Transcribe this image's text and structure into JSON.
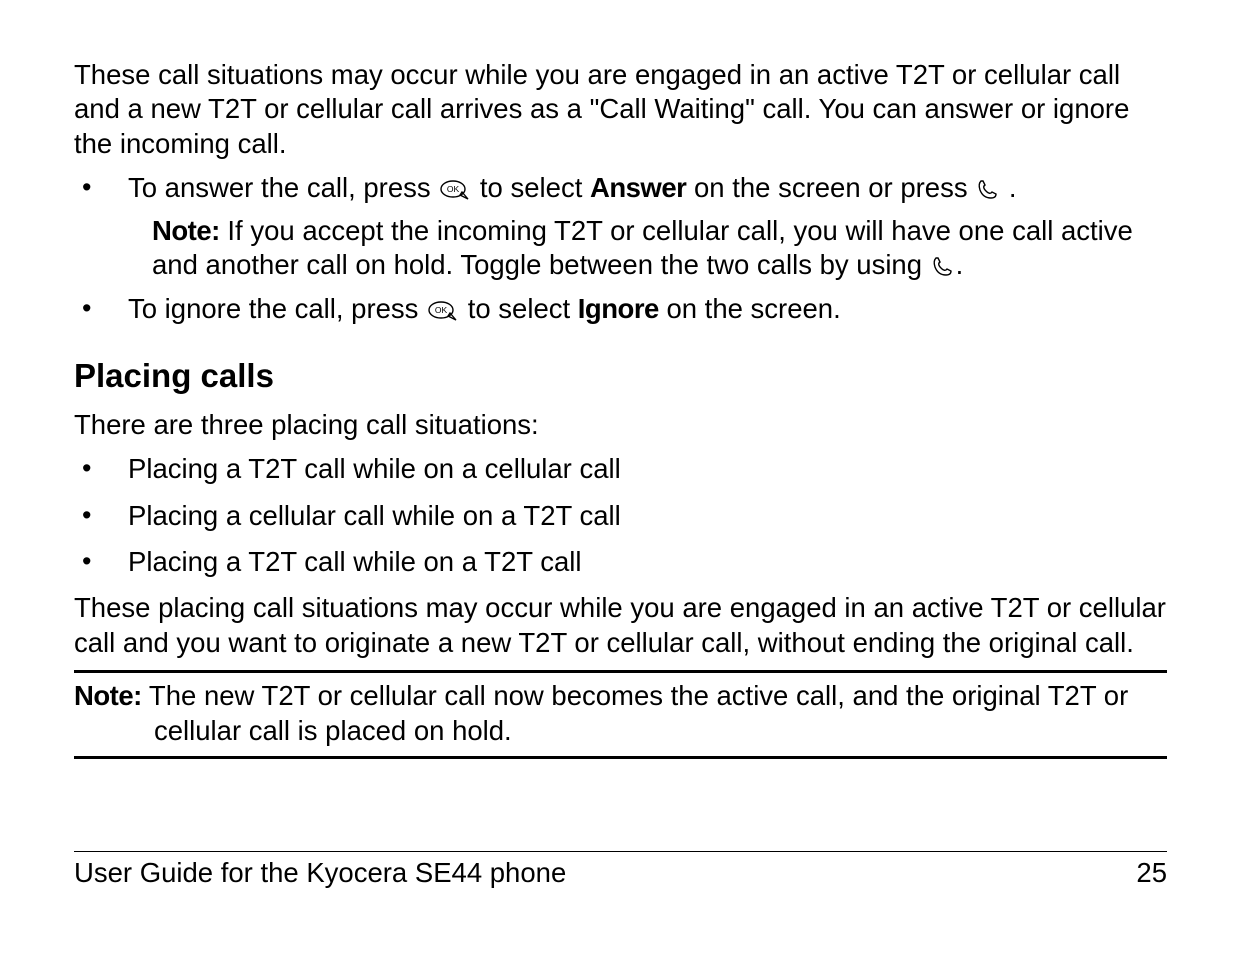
{
  "intro": "These call situations may occur while you are engaged in an active T2T or cellular call and a new T2T or cellular call arrives as a \"Call Waiting\" call. You can answer or ignore the incoming call.",
  "bullet1": {
    "a": "To answer the call, press ",
    "b": " to select ",
    "answer": "Answer",
    "c": " on the screen or press ",
    "d": "."
  },
  "note1": {
    "label": "Note:",
    "a": "  If you accept the incoming T2T or cellular call, you will have one call active and another call on hold. Toggle between the two calls by using ",
    "b": "."
  },
  "bullet2": {
    "a": "To ignore the call, press ",
    "b": " to select ",
    "ignore": "Ignore",
    "c": " on the screen."
  },
  "section_heading": "Placing calls",
  "placing_intro": "There are three placing call situations:",
  "placing_items": [
    "Placing a T2T call while on a cellular call",
    "Placing a cellular call while on a T2T call",
    "Placing a T2T call while on a T2T call"
  ],
  "placing_para": "These placing call situations may occur while you are engaged in an active T2T or cellular call and you want to originate a new T2T or cellular call, without ending the original call.",
  "note_box": {
    "label": "Note:",
    "text": " The new T2T or cellular call now becomes the active call, and the original T2T or cellular call is placed on hold."
  },
  "footer": {
    "left": "User Guide for the Kyocera SE44 phone",
    "right": "25"
  },
  "icons": {
    "ok": "ok-bubble-icon",
    "talk": "talk-handset-icon"
  }
}
